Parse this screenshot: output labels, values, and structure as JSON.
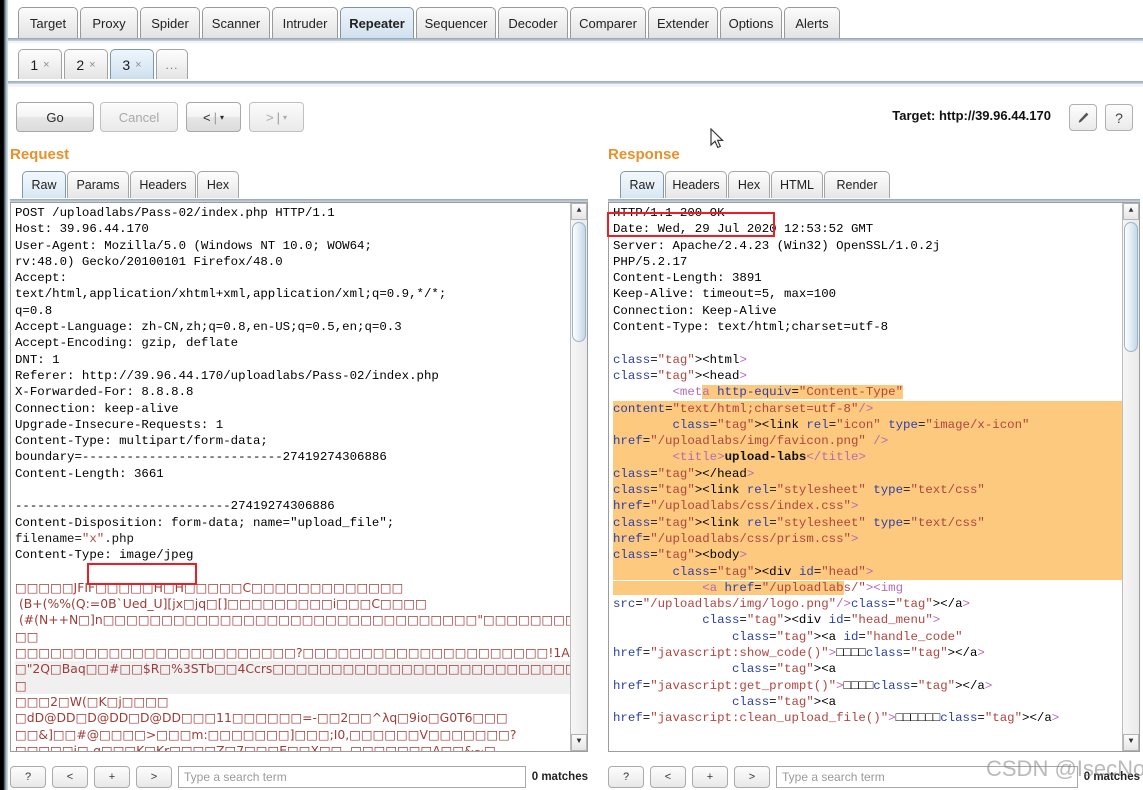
{
  "app": {
    "main_tabs": [
      "Target",
      "Proxy",
      "Spider",
      "Scanner",
      "Intruder",
      "Repeater",
      "Sequencer",
      "Decoder",
      "Comparer",
      "Extender",
      "Options",
      "Alerts"
    ],
    "main_tab_selected": "Repeater",
    "sub_tabs": [
      {
        "label": "1",
        "close": "×"
      },
      {
        "label": "2",
        "close": "×"
      },
      {
        "label": "3",
        "close": "×"
      }
    ],
    "sub_tab_more": "...",
    "sub_tab_selected": "3"
  },
  "toolbar": {
    "go": "Go",
    "cancel": "Cancel",
    "back": "<",
    "forward": ">",
    "caret": "▾",
    "separator": "|",
    "target_label": "Target: http://39.96.44.170",
    "edit_icon": "pencil-icon",
    "help_label": "?"
  },
  "request": {
    "title": "Request",
    "tabs": [
      "Raw",
      "Params",
      "Headers",
      "Hex"
    ],
    "selected_tab": "Raw",
    "highlight_box_text": "\"x\".php",
    "lines": [
      "POST /uploadlabs/Pass-02/index.php HTTP/1.1",
      "Host: 39.96.44.170",
      "User-Agent: Mozilla/5.0 (Windows NT 10.0; WOW64;",
      "rv:48.0) Gecko/20100101 Firefox/48.0",
      "Accept:",
      "text/html,application/xhtml+xml,application/xml;q=0.9,*/*;",
      "q=0.8",
      "Accept-Language: zh-CN,zh;q=0.8,en-US;q=0.5,en;q=0.3",
      "Accept-Encoding: gzip, deflate",
      "DNT: 1",
      "Referer: http://39.96.44.170/uploadlabs/Pass-02/index.php",
      "X-Forwarded-For: 8.8.8.8",
      "Connection: keep-alive",
      "Upgrade-Insecure-Requests: 1",
      "Content-Type: multipart/form-data;",
      "boundary=---------------------------27419274306886",
      "Content-Length: 3661",
      "",
      "-----------------------------27419274306886",
      "Content-Disposition: form-data; name=\"upload_file\";",
      "filename=\"x\".php",
      "Content-Type: image/jpeg",
      ""
    ],
    "binary_lines": [
      "□□□□□JFIF□□□□□H□H□□□□□C□□□□□□□□□□□□□",
      " (B+(%%(Q:=0B`Ued_U][jx□jq□[]□□□□□□□□□i□□□C□□□□",
      " (#(N++N□]n□□□□□□□□□□□□□□□□□□□□□□□□□□□□□□□□\"□□□□□□□□□□",
      "□□□□□□□□□□□□□□□□□□□□□□□□?□□□□□□□□□□□□□□□□□□□□□!1A□",
      "□\"2Q□Baq□□#□□$R□%3STb□□4Ccrs□□□□□□□□□□□□□□□□□□□□□□□□□□□",
      "□□□2□W(□K□j□□□□",
      "□dD@DD□D@DD□D@DD□□□11□□□□□□=-□□2□□^λq□9io□G0T6□□□",
      "□□&]□□#@□□□□>□□□m:□□□□□□□]□□□;I0,□□□□□□V□□□□□□□?",
      "□□□□□j□-q□□□K□Kr□□□□Z□7□□□E□□X□□..□□□□□□□A□□&~□"
    ]
  },
  "response": {
    "title": "Response",
    "tabs": [
      "Raw",
      "Headers",
      "Hex",
      "HTML",
      "Render"
    ],
    "selected_tab": "Raw",
    "highlight_box_text": "HTTP/1.1 200 OK",
    "header_lines": [
      "HTTP/1.1 200 OK",
      "Date: Wed, 29 Jul 2020 12:53:52 GMT",
      "Server: Apache/2.4.23 (Win32) OpenSSL/1.0.2j",
      "PHP/5.2.17",
      "Content-Length: 3891",
      "Keep-Alive: timeout=5, max=100",
      "Connection: Keep-Alive",
      "Content-Type: text/html;charset=utf-8",
      ""
    ],
    "body_lines": [
      "<html>",
      "<head>",
      "        <meta http-equiv=\"Content-Type\"",
      "content=\"text/html;charset=utf-8\"/>",
      "        <link rel=\"icon\" type=\"image/x-icon\"",
      "href=\"/uploadlabs/img/favicon.png\" />",
      "        <title>upload-labs</title>",
      "</head>",
      "<link rel=\"stylesheet\" type=\"text/css\"",
      "href=\"/uploadlabs/css/index.css\">",
      "<link rel=\"stylesheet\" type=\"text/css\"",
      "href=\"/uploadlabs/css/prism.css\">",
      "<body>",
      "        <div id=\"head\">",
      "            <a href=\"/uploadlabs/\"><img",
      "src=\"/uploadlabs/img/logo.png\"/></a>",
      "            <div id=\"head_menu\">",
      "                <a id=\"handle_code\"",
      "href=\"javascript:show_code()\">□□□□</a>",
      "                <a",
      "href=\"javascript:get_prompt()\">□□□□</a>",
      "                <a",
      "href=\"javascript:clean_upload_file()\">□□□□□□</a>"
    ]
  },
  "search_bar": {
    "buttons": [
      "?",
      "<",
      "+",
      ">"
    ],
    "placeholder": "Type a search term",
    "matches": "0 matches"
  },
  "watermark": "CSDN @IsecNoob",
  "colors": {
    "accent_orange": "#e8912a",
    "highlight_orange": "#fcc97e",
    "red_box": "#ee1c24",
    "binary_red": "#9e3b38",
    "tag_purple": "#b56bb5",
    "attr_blue": "#2c3fa8",
    "value_red": "#b0453f"
  }
}
